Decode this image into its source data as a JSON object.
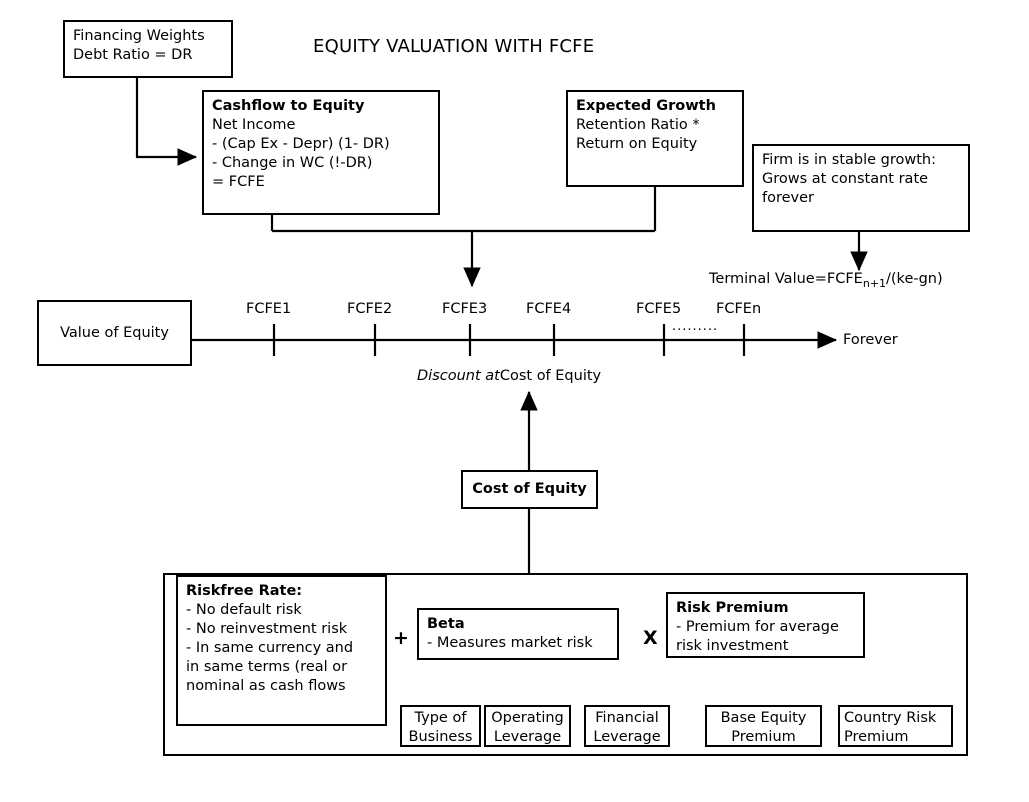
{
  "diagram": {
    "title": "EQUITY VALUATION WITH FCFE"
  },
  "boxes": {
    "financing_weights": {
      "line1": "Financing Weights",
      "line2": "Debt Ratio = DR"
    },
    "cashflow_to_equity": {
      "header": "Cashflow to Equity",
      "line1": "Net Income",
      "line2": "- (Cap Ex - Depr) (1- DR)",
      "line3": "- Change in WC (!-DR)",
      "line4": "= FCFE"
    },
    "expected_growth": {
      "header": "Expected Growth",
      "line1": "Retention Ratio *",
      "line2": "Return on Equity"
    },
    "stable_growth": {
      "line1": "Firm is in stable growth:",
      "line2": "Grows at constant rate",
      "line3": "forever"
    },
    "value_of_equity": {
      "label": "Value of Equity"
    },
    "cost_of_equity": {
      "label": "Cost of Equity"
    },
    "riskfree_rate": {
      "header": "Riskfree Rate:",
      "line1": "- No default risk",
      "line2": "- No reinvestment risk",
      "line3": "- In same currency and",
      "line4": "in same terms (real or",
      "line5": "nominal as cash flows"
    },
    "beta": {
      "header": "Beta",
      "line1": "- Measures market risk"
    },
    "risk_premium": {
      "header": "Risk Premium",
      "line1": "- Premium for average",
      "line2": "risk investment"
    },
    "type_of_business": {
      "line1": "Type of",
      "line2": "Business"
    },
    "operating_leverage": {
      "line1": "Operating",
      "line2": "Leverage"
    },
    "financial_leverage": {
      "line1": "Financial",
      "line2": "Leverage"
    },
    "base_equity_premium": {
      "line1": "Base Equity",
      "line2": "Premium"
    },
    "country_risk_premium": {
      "line1": "Country Risk",
      "line2": "Premium"
    }
  },
  "labels": {
    "terminal_value_prefix": "Terminal Value=FCFE",
    "terminal_value_sub": "n+1",
    "terminal_value_suffix": "/(ke-gn)",
    "discount_italic": "Discount at",
    "discount_rest": "Cost of Equity",
    "forever": "Forever",
    "ellipsis": "·········",
    "plus_operator": "+",
    "times_operator": "X"
  },
  "timeline": {
    "ticks": [
      {
        "label": "FCFE1"
      },
      {
        "label": "FCFE2"
      },
      {
        "label": "FCFE3"
      },
      {
        "label": "FCFE4"
      },
      {
        "label": "FCFE5"
      },
      {
        "label": "FCFEn"
      }
    ]
  }
}
